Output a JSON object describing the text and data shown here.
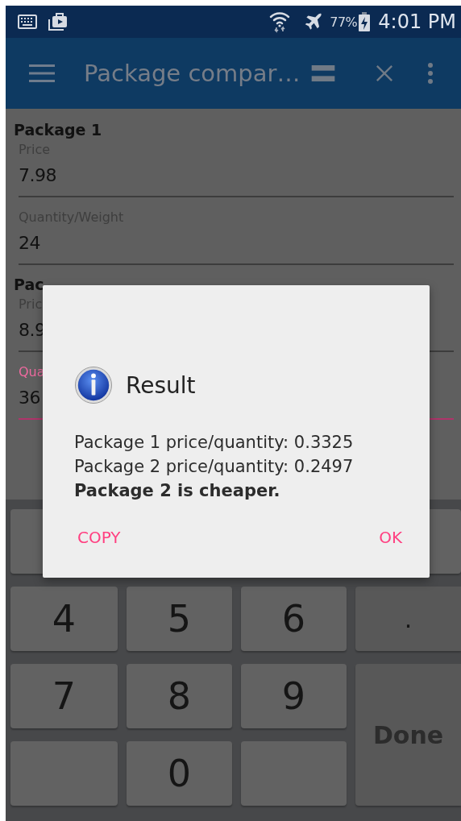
{
  "status_bar": {
    "battery": "77%",
    "time": "4:01 PM"
  },
  "app_bar": {
    "title": "Package compar…"
  },
  "form": [
    {
      "heading": "Package 1",
      "fields": [
        {
          "label": "Price",
          "value": "7.98",
          "focused": false
        },
        {
          "label": "Quantity/Weight",
          "value": "24",
          "focused": false
        }
      ]
    },
    {
      "heading": "Pac",
      "fields": [
        {
          "label": "Pric",
          "value": "8.9",
          "focused": false
        },
        {
          "label": "Qua",
          "value": "36",
          "focused": true
        }
      ]
    }
  ],
  "keyboard": [
    {
      "kind": "blank"
    },
    {
      "kind": "hidden"
    },
    {
      "kind": "hidden"
    },
    {
      "kind": "blank"
    },
    {
      "kind": "char",
      "label": "4"
    },
    {
      "kind": "char",
      "label": "5"
    },
    {
      "kind": "char",
      "label": "6"
    },
    {
      "kind": "symbol",
      "label": "."
    },
    {
      "kind": "char",
      "label": "7"
    },
    {
      "kind": "char",
      "label": "8"
    },
    {
      "kind": "char",
      "label": "9"
    },
    {
      "kind": "action",
      "label": "Done"
    },
    {
      "kind": "blank"
    },
    {
      "kind": "char",
      "label": "0"
    },
    {
      "kind": "blank"
    }
  ],
  "dialog": {
    "title": "Result",
    "lines": [
      {
        "text": "Package 1 price/quantity: 0.3325",
        "bold": false
      },
      {
        "text": "Package 2 price/quantity: 0.2497",
        "bold": false
      },
      {
        "text": "Package 2 is cheaper.",
        "bold": true
      }
    ],
    "buttons": [
      "COPY",
      "OK"
    ]
  }
}
